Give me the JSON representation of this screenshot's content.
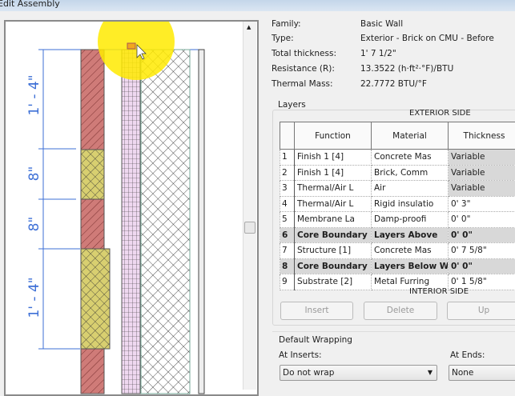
{
  "window": {
    "title": "Edit Assembly"
  },
  "preview": {
    "dimensions": [
      "1' - 4\"",
      "8\"",
      "8\"",
      "1' - 4\""
    ]
  },
  "info": [
    {
      "label": "Family:",
      "value": "Basic Wall"
    },
    {
      "label": "Type:",
      "value": "Exterior - Brick on CMU - Before"
    },
    {
      "label": "Total thickness:",
      "value": "1'  7 1/2\""
    },
    {
      "label": "Resistance (R):",
      "value": "13.3522 (h·ft²·°F)/BTU"
    },
    {
      "label": "Thermal Mass:",
      "value": "22.7772 BTU/°F"
    }
  ],
  "layers": {
    "group_label": "Layers",
    "exterior": "EXTERIOR SIDE",
    "interior": "INTERIOR SIDE",
    "headers": [
      "Function",
      "Material",
      "Thickness"
    ],
    "rows": [
      {
        "n": "1",
        "function": "Finish 1 [4]",
        "material": "Concrete Mas",
        "thickness": "Variable"
      },
      {
        "n": "2",
        "function": "Finish 1 [4]",
        "material": "Brick, Comm",
        "thickness": "Variable"
      },
      {
        "n": "3",
        "function": "Thermal/Air L",
        "material": "Air",
        "thickness": "Variable"
      },
      {
        "n": "4",
        "function": "Thermal/Air L",
        "material": "Rigid insulatio",
        "thickness": "0'  3\""
      },
      {
        "n": "5",
        "function": "Membrane La",
        "material": "Damp-proofi",
        "thickness": "0'  0\""
      },
      {
        "n": "6",
        "function": "Core Boundary",
        "material": "Layers Above",
        "thickness": "0'  0\""
      },
      {
        "n": "7",
        "function": "Structure [1]",
        "material": "Concrete Mas",
        "thickness": "0'  7 5/8\""
      },
      {
        "n": "8",
        "function": "Core Boundary",
        "material": "Layers Below W",
        "thickness": "0'  0\""
      },
      {
        "n": "9",
        "function": "Substrate [2]",
        "material": "Metal Furring",
        "thickness": "0'  1 5/8\""
      }
    ],
    "buttons": {
      "insert": "Insert",
      "delete": "Delete",
      "up": "Up"
    }
  },
  "wrapping": {
    "label": "Default Wrapping",
    "inserts_label": "At Inserts:",
    "inserts_value": "Do not wrap",
    "ends_label": "At Ends:",
    "ends_value": "None"
  }
}
